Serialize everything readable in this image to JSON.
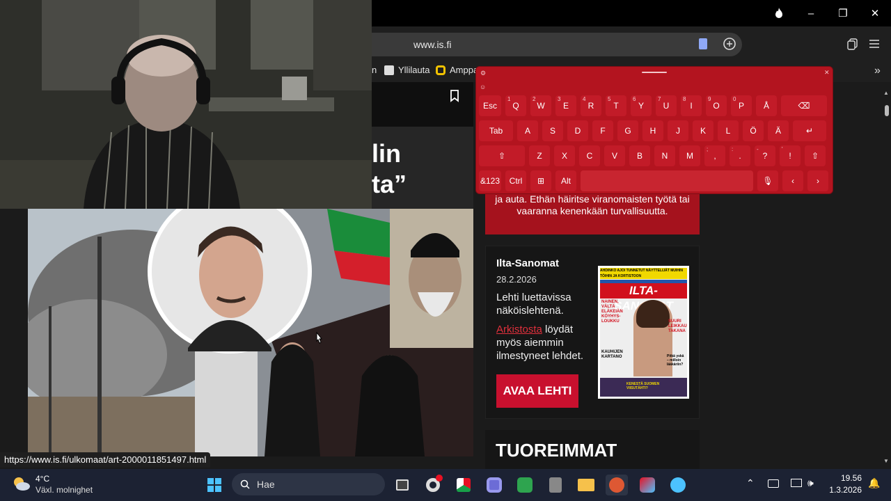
{
  "browser": {
    "url": "www.is.fi",
    "bookmarks": [
      {
        "label": "n"
      },
      {
        "label": "Yllilauta"
      },
      {
        "label": "Amppa"
      }
    ],
    "window_controls": {
      "minimize": "–",
      "restore": "❐",
      "close": "✕"
    }
  },
  "article": {
    "headline_part1": "lin",
    "headline_part2": "ta”"
  },
  "alert": {
    "line1": "ja auta. Ethän häiritse viranomaisten työtä tai",
    "line2": "vaaranna kenenkään turvallisuutta."
  },
  "epaper": {
    "title": "Ilta-Sanomat",
    "date": "28.2.2026",
    "text1": "Lehti luettavissa näköislehtenä.",
    "archive_link": "Arkistosta",
    "text2": " löydät myös aiemmin ilmestyneet lehdet.",
    "button": "AVAA LEHTI",
    "cover": {
      "masthead": "ILTA-SANOMAT",
      "top_banner": "AHDINKO AJOI TUNNETUT NÄYTTELIJÄT MUIHIN TÖIHIN JA KORTISTOON",
      "headline1": "NAINEN, VÄLTÄ ELÄKEIÄN KÖYHYS-LOUKKU",
      "headline2": "SUURI LEIKKAUS TAKANA",
      "headline3": "KAUHIJEN KARTANO",
      "headline4": "Pitkä yskä – milloin lääkäriin?",
      "headline5": "KENESTÄ SUOMEN VIISUTÄHTI?"
    }
  },
  "section": {
    "tuoreimmat": "TUOREIMMAT"
  },
  "statusbar": {
    "link": "https://www.is.fi/ulkomaat/art-2000011851497.html"
  },
  "keyboard": {
    "row1": [
      {
        "k": "Esc",
        "s": ""
      },
      {
        "k": "Q",
        "s": "1"
      },
      {
        "k": "W",
        "s": "2"
      },
      {
        "k": "E",
        "s": "3"
      },
      {
        "k": "R",
        "s": "4"
      },
      {
        "k": "T",
        "s": "5"
      },
      {
        "k": "Y",
        "s": "6"
      },
      {
        "k": "U",
        "s": "7"
      },
      {
        "k": "I",
        "s": "8"
      },
      {
        "k": "O",
        "s": "9"
      },
      {
        "k": "P",
        "s": "0"
      },
      {
        "k": "Å",
        "s": ""
      },
      {
        "k": "⌫",
        "s": ""
      }
    ],
    "row2": [
      {
        "k": "Tab",
        "s": ""
      },
      {
        "k": "A",
        "s": ""
      },
      {
        "k": "S",
        "s": ""
      },
      {
        "k": "D",
        "s": ""
      },
      {
        "k": "F",
        "s": ""
      },
      {
        "k": "G",
        "s": ""
      },
      {
        "k": "H",
        "s": ""
      },
      {
        "k": "J",
        "s": ""
      },
      {
        "k": "K",
        "s": ""
      },
      {
        "k": "L",
        "s": ""
      },
      {
        "k": "Ö",
        "s": ""
      },
      {
        "k": "Ä",
        "s": ""
      },
      {
        "k": "↵",
        "s": ""
      }
    ],
    "row3": [
      {
        "k": "⇧",
        "s": ""
      },
      {
        "k": "Z",
        "s": ""
      },
      {
        "k": "X",
        "s": ""
      },
      {
        "k": "C",
        "s": ""
      },
      {
        "k": "V",
        "s": ""
      },
      {
        "k": "B",
        "s": ""
      },
      {
        "k": "N",
        "s": ""
      },
      {
        "k": "M",
        "s": ""
      },
      {
        "k": ",",
        "s": ";"
      },
      {
        "k": ".",
        "s": ":"
      },
      {
        "k": "?",
        "s": "-"
      },
      {
        "k": "!",
        "s": "'"
      },
      {
        "k": "⇧",
        "s": ""
      }
    ],
    "row4": [
      {
        "k": "&123",
        "s": ""
      },
      {
        "k": "Ctrl",
        "s": ""
      },
      {
        "k": "⊞",
        "s": ""
      },
      {
        "k": "Alt",
        "s": ""
      },
      {
        "k": "",
        "s": ""
      },
      {
        "k": "🎙",
        "s": ""
      },
      {
        "k": "‹",
        "s": ""
      },
      {
        "k": "›",
        "s": ""
      }
    ]
  },
  "taskbar": {
    "weather_temp": "4°C",
    "weather_desc": "Växl. molnighet",
    "search_placeholder": "Hae",
    "time": "19.56",
    "date": "1.3.2026"
  },
  "colors": {
    "accent_red": "#c8102e",
    "keyboard_red": "#b3141f",
    "taskbar": "#1c2233"
  }
}
